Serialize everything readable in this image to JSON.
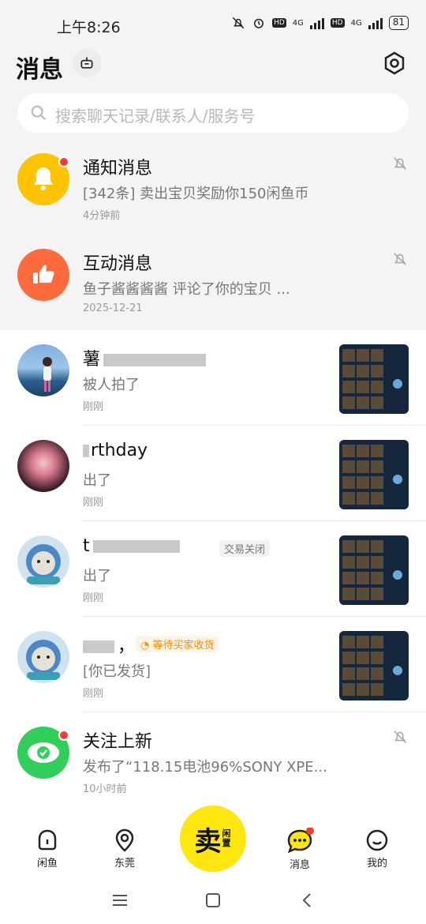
{
  "status_bar": {
    "time": "上午8:26",
    "network1": "4G",
    "network2": "4G",
    "hd": "HD",
    "battery": "81"
  },
  "header": {
    "title": "消息"
  },
  "search": {
    "placeholder": "搜索聊天记录/联系人/服务号"
  },
  "conversations": [
    {
      "name": "通知消息",
      "preview": "[342条] 卖出宝贝奖励你150闲鱼币",
      "time": "4分钟前",
      "muted": true,
      "unread_dot": true,
      "avatar_icon": "bell-icon"
    },
    {
      "name": "互动消息",
      "preview": "鱼子酱酱酱酱 评论了你的宝贝 ...",
      "time": "2025-12-21",
      "muted": true,
      "avatar_icon": "thumbs-up-icon"
    },
    {
      "name": "薯",
      "preview": "被人拍了",
      "time": "刚刚"
    },
    {
      "name": "rthday",
      "preview": "出了",
      "time": "刚刚"
    },
    {
      "name": "t",
      "preview": "出了",
      "time": "刚刚",
      "tag": "交易关闭"
    },
    {
      "name": "，",
      "preview": "[你已发货]",
      "time": "刚刚",
      "tag": "等待买家收货"
    },
    {
      "name": "关注上新",
      "preview": "发布了“118.15电池96%SONY XPE...",
      "time": "10小时前",
      "muted": true,
      "unread_dot": true,
      "avatar_icon": "eye-icon"
    }
  ],
  "bottom_nav": {
    "home": "闲鱼",
    "location": "东莞",
    "sell_big": "卖",
    "sell_small": "闲置",
    "messages": "消息",
    "me": "我的"
  },
  "colors": {
    "brand_yellow": "#ffe60f",
    "notify_yellow": "#ffc300",
    "interaction_orange": "#ff6a3d",
    "follow_green": "#2fcf5a",
    "red_dot": "#ff3b30",
    "tag_orange": "#ff8a00"
  }
}
